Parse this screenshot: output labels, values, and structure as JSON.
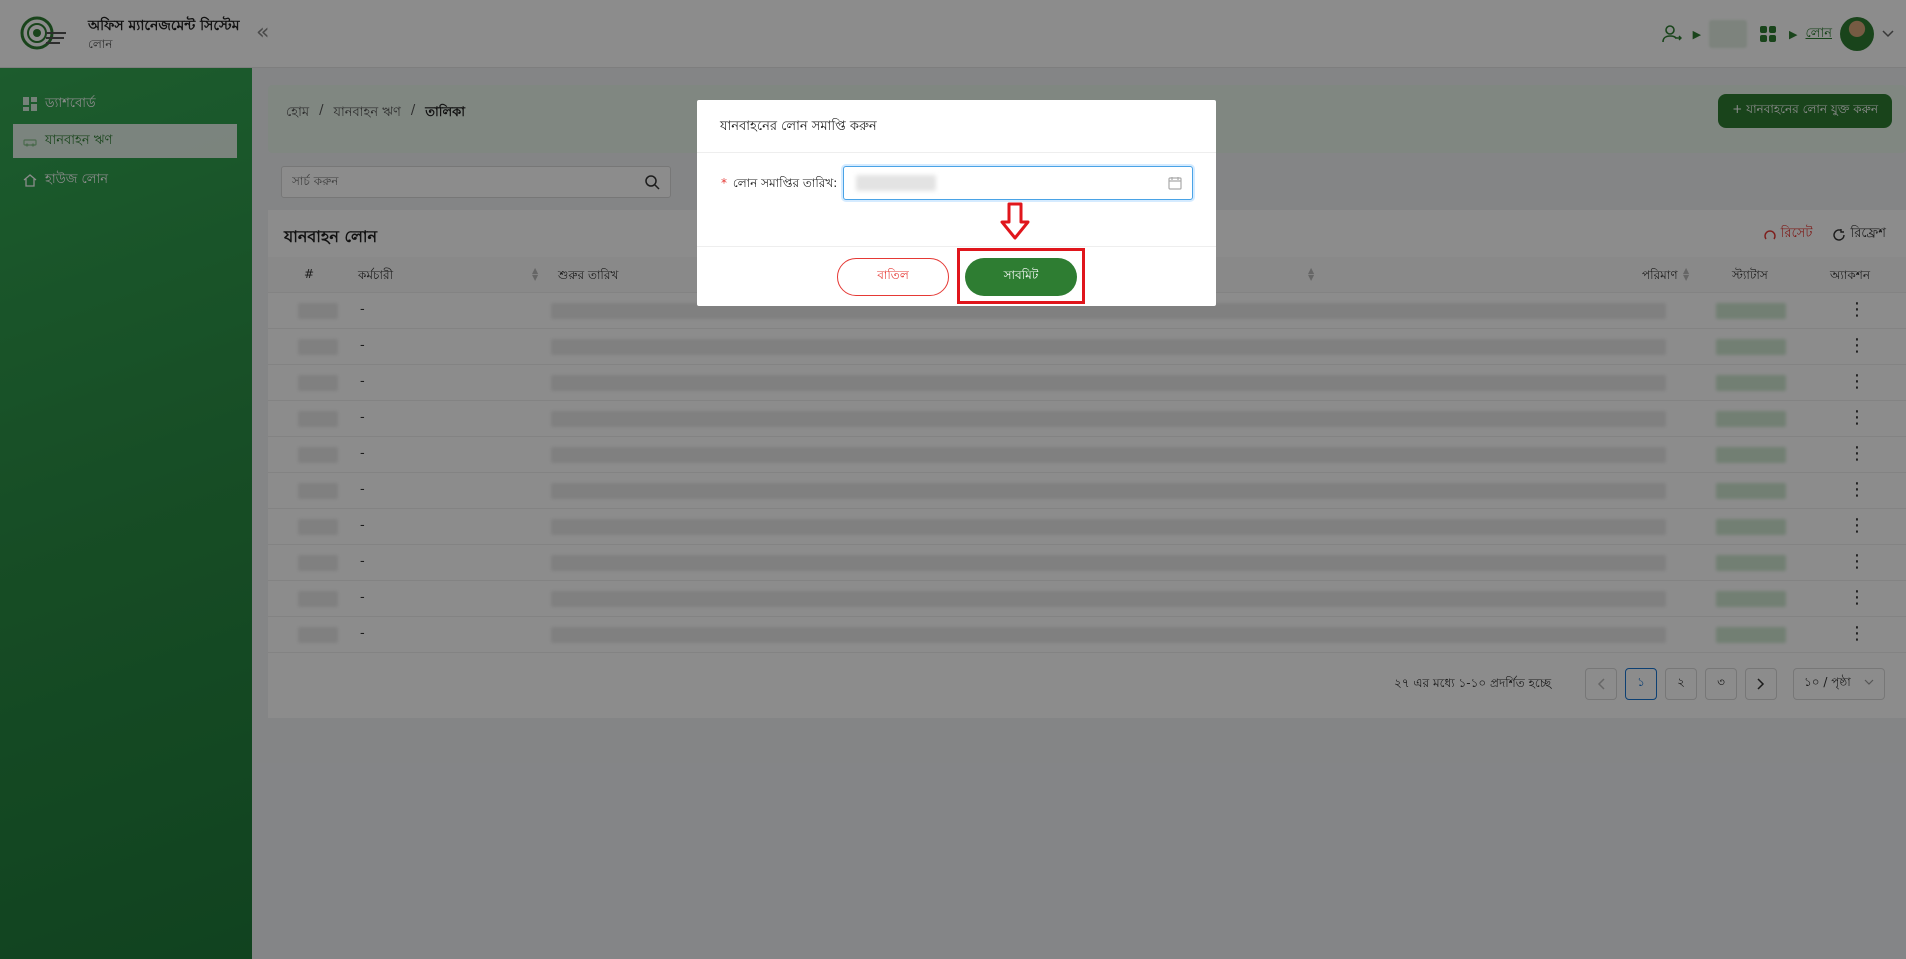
{
  "header": {
    "app_title": "অফিস ম্যানেজমেন্ট সিস্টেম",
    "app_subtitle": "লোন",
    "collapse_icon": "«",
    "module_link": "লোন"
  },
  "sidebar": {
    "items": [
      {
        "label": "ড্যাশবোর্ড",
        "icon": "dashboard-icon"
      },
      {
        "label": "যানবাহন ঋণ",
        "icon": "car-icon",
        "active": true
      },
      {
        "label": "হাউজ লোন",
        "icon": "home-icon"
      }
    ]
  },
  "breadcrumb": {
    "home": "হোম",
    "section": "যানবাহন ঋণ",
    "current": "তালিকা",
    "separator": "/"
  },
  "add_button_label": "+ যানবাহনের লোন যুক্ত করুন",
  "search": {
    "placeholder": "সার্চ করুন",
    "value": ""
  },
  "table": {
    "title": "যানবাহন লোন",
    "reset_label": "রিসেট",
    "refresh_label": "রিফ্রেশ",
    "columns": {
      "index": "#",
      "employee": "কর্মচারী",
      "start_date": "শুরুর তারিখ",
      "amount": "পরিমাণ",
      "status": "স্ট্যাটাস",
      "action": "অ্যাকশন"
    },
    "employee_cell": "-",
    "action_icon": "⋮"
  },
  "pagination": {
    "info": "২৭ এর মধ্যে ১-১০ প্রদর্শিত হচ্ছে",
    "pages": [
      "১",
      "২",
      "৩"
    ],
    "page_size": "১০ / পৃষ্ঠা"
  },
  "modal": {
    "title": "যানবাহনের লোন সমাপ্তি করুন",
    "required_mark": "*",
    "field_label": "লোন সমাপ্তির তারিখ:",
    "cancel_label": "বাতিল",
    "submit_label": "সাবমিট"
  },
  "colors": {
    "primary_green": "#2e7d32",
    "danger_red": "#e53935",
    "highlight_red": "#e0161c"
  }
}
